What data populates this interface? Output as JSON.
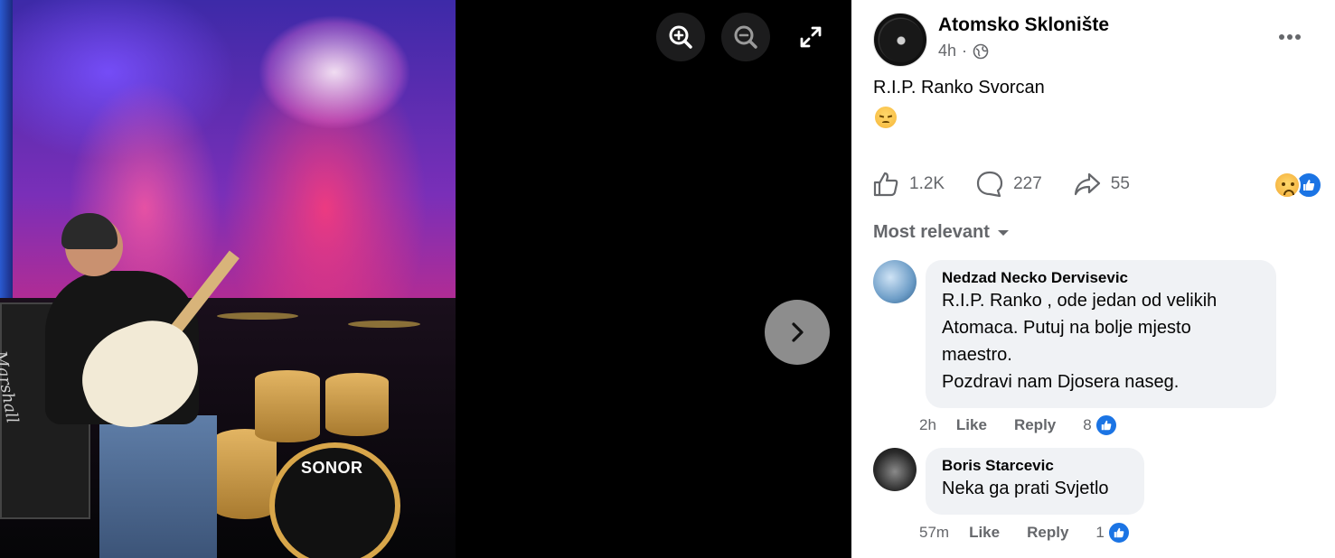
{
  "viewer": {
    "photo_brand_label": "SONOR",
    "amp_label": "Marshall",
    "controls": {
      "zoom_in_icon": "zoom-in-icon",
      "zoom_out_icon": "zoom-out-icon",
      "fullscreen_icon": "expand-icon",
      "next_icon": "chevron-right-icon"
    }
  },
  "post": {
    "author": "Atomsko Sklonište",
    "time": "4h",
    "privacy_icon": "globe-icon",
    "text": "R.I.P. Ranko Svorcan",
    "emoji": "pensive-face",
    "stats": {
      "likes": "1.2K",
      "comments": "227",
      "shares": "55"
    },
    "reactions": [
      "sad",
      "like"
    ]
  },
  "comments_section": {
    "sort_label": "Most relevant",
    "comments": [
      {
        "author": "Nedzad Necko Dervisevic",
        "lines": [
          "R.I.P. Ranko , ode jedan od velikih",
          "Atomaca. Putuj na bolje mjesto",
          "maestro.",
          "Pozdravi nam Djosera naseg."
        ],
        "time": "2h",
        "like_label": "Like",
        "reply_label": "Reply",
        "reaction_count": "8"
      },
      {
        "author": "Boris Starcevic",
        "lines": [
          "Neka ga prati Svjetlo"
        ],
        "time": "57m",
        "like_label": "Like",
        "reply_label": "Reply",
        "reaction_count": "1"
      }
    ]
  },
  "colors": {
    "accent": "#1b74e4",
    "muted_text": "#65676b",
    "bubble": "#f0f2f5"
  }
}
